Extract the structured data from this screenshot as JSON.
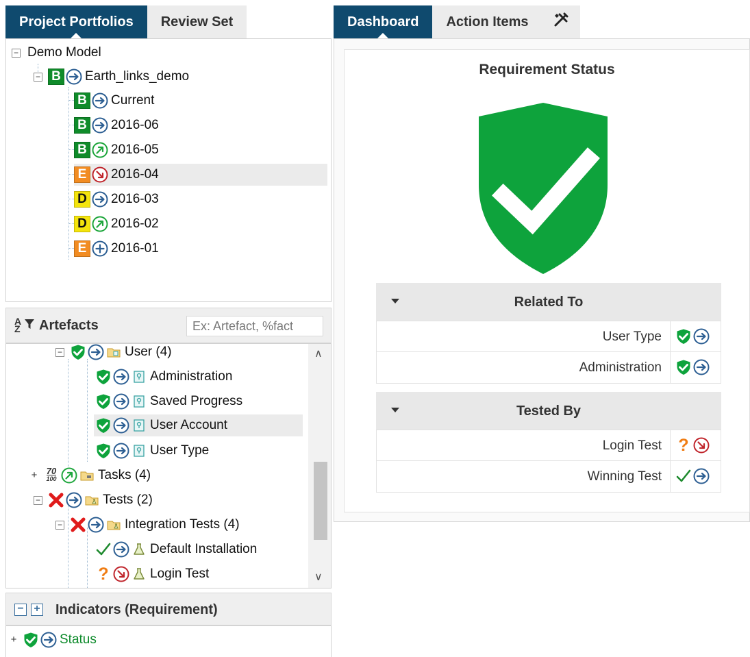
{
  "left_tabs": [
    {
      "label": "Project Portfolios",
      "active": true
    },
    {
      "label": "Review Set",
      "active": false
    }
  ],
  "portfolio_tree": {
    "root": "Demo Model",
    "project": {
      "grade": "B",
      "trend": "stable",
      "label": "Earth_links_demo"
    },
    "versions": [
      {
        "grade": "B",
        "trend": "stable",
        "label": "Current"
      },
      {
        "grade": "B",
        "trend": "stable",
        "label": "2016-06"
      },
      {
        "grade": "B",
        "trend": "up",
        "label": "2016-05"
      },
      {
        "grade": "E",
        "trend": "down",
        "label": "2016-04",
        "selected": true
      },
      {
        "grade": "D",
        "trend": "stable",
        "label": "2016-03"
      },
      {
        "grade": "D",
        "trend": "up",
        "label": "2016-02"
      },
      {
        "grade": "E",
        "trend": "new",
        "label": "2016-01"
      }
    ]
  },
  "artefacts": {
    "title": "Artefacts",
    "filter_placeholder": "Ex: Artefact, %fact",
    "items": [
      {
        "label": "User (4)",
        "status": "shield",
        "trend": "stable",
        "type": "folder-req"
      },
      {
        "label": "Administration",
        "status": "shield",
        "trend": "stable",
        "type": "requirement"
      },
      {
        "label": "Saved Progress",
        "status": "shield",
        "trend": "stable",
        "type": "requirement"
      },
      {
        "label": "User Account",
        "status": "shield",
        "trend": "stable",
        "type": "requirement",
        "selected": true
      },
      {
        "label": "User Type",
        "status": "shield",
        "trend": "stable",
        "type": "requirement"
      },
      {
        "label": "Tasks (4)",
        "status": "score",
        "score_num": "70",
        "score_den": "100",
        "trend": "up",
        "type": "folder-task"
      },
      {
        "label": "Tests (2)",
        "status": "fail",
        "trend": "stable",
        "type": "folder-test"
      },
      {
        "label": "Integration Tests (4)",
        "status": "fail",
        "trend": "stable",
        "type": "folder-test"
      },
      {
        "label": "Default Installation",
        "status": "pass",
        "trend": "stable",
        "type": "test"
      },
      {
        "label": "Login Test",
        "status": "unknown",
        "trend": "down",
        "type": "test"
      }
    ]
  },
  "indicators": {
    "title": "Indicators (Requirement)",
    "items": [
      {
        "label": "Status",
        "status": "shield",
        "trend": "stable"
      }
    ]
  },
  "right_tabs": [
    {
      "label": "Dashboard",
      "active": true
    },
    {
      "label": "Action Items",
      "active": false
    }
  ],
  "tools_tab_icon": "tools-icon",
  "dashboard": {
    "title": "Requirement Status",
    "related": {
      "heading": "Related To",
      "rows": [
        {
          "name": "User Type",
          "status": "shield",
          "trend": "stable"
        },
        {
          "name": "Administration",
          "status": "shield",
          "trend": "stable"
        }
      ]
    },
    "tested": {
      "heading": "Tested By",
      "rows": [
        {
          "name": "Login Test",
          "status": "unknown",
          "trend": "down"
        },
        {
          "name": "Winning Test",
          "status": "pass",
          "trend": "stable"
        }
      ]
    }
  },
  "colors": {
    "tab_active": "#0f4a6e",
    "grade_B": "#0f8b2a",
    "grade_E": "#f28c22",
    "grade_D": "#f4e40c",
    "shield_green": "#0ea33c",
    "fail_red": "#e01b1b",
    "trend_blue": "#2d5f93",
    "trend_green": "#1ea63c",
    "trend_red": "#c0252c",
    "unknown_orange": "#f07d14"
  }
}
